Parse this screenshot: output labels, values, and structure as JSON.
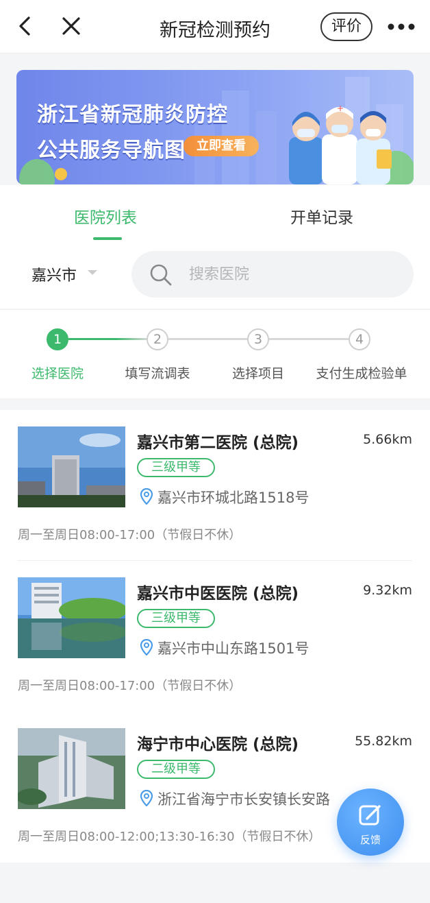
{
  "nav": {
    "title": "新冠检测预约",
    "rate_label": "评价"
  },
  "banner": {
    "line1": "浙江省新冠肺炎防控",
    "line2": "公共服务导航图",
    "cta": "立即查看"
  },
  "tabs": [
    {
      "label": "医院列表",
      "active": true
    },
    {
      "label": "开单记录",
      "active": false
    }
  ],
  "filter": {
    "city": "嘉兴市",
    "search_placeholder": "搜索医院"
  },
  "steps": [
    {
      "number": "1",
      "label": "选择医院",
      "active": true
    },
    {
      "number": "2",
      "label": "填写流调表",
      "active": false
    },
    {
      "number": "3",
      "label": "选择项目",
      "active": false
    },
    {
      "number": "4",
      "label": "支付生成检验单",
      "active": false
    }
  ],
  "hospitals": [
    {
      "name": "嘉兴市第二医院 (总院)",
      "distance": "5.66km",
      "grade": "三级甲等",
      "address": "嘉兴市环城北路1518号",
      "hours": "周一至周日08:00-17:00（节假日不休）"
    },
    {
      "name": "嘉兴市中医医院 (总院)",
      "distance": "9.32km",
      "grade": "三级甲等",
      "address": "嘉兴市中山东路1501号",
      "hours": "周一至周日08:00-17:00（节假日不休）"
    },
    {
      "name": "海宁市中心医院 (总院)",
      "distance": "55.82km",
      "grade": "二级甲等",
      "address": "浙江省海宁市长安镇长安路",
      "hours": "周一至周日08:00-12:00;13:30-16:30（节假日不休）"
    }
  ],
  "fab": {
    "label": "反馈"
  },
  "colors": {
    "accent": "#3cb96c",
    "fab": "#3d8ef0",
    "banner": "#7b92ee"
  }
}
